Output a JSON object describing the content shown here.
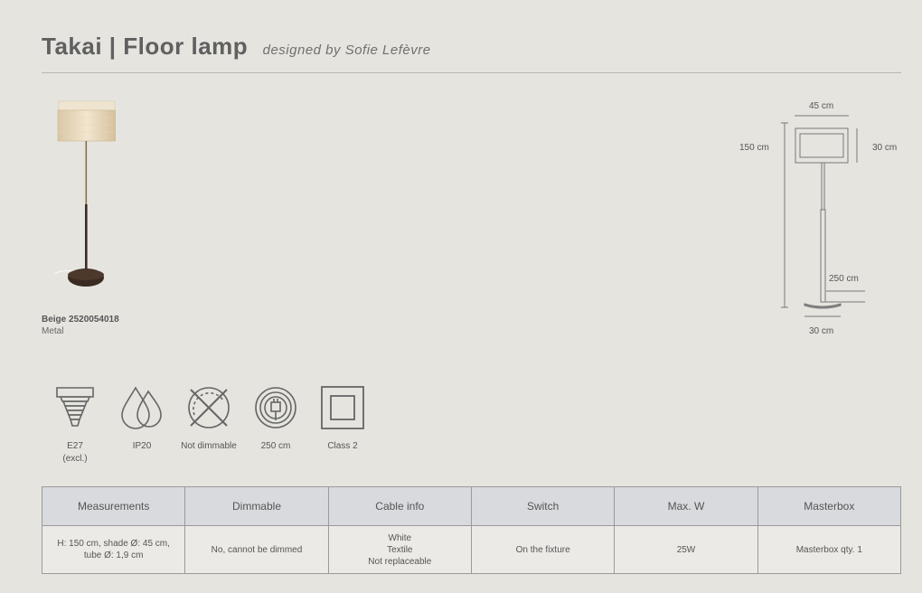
{
  "header": {
    "title": "Takai | Floor lamp",
    "subtitle": "designed by Sofie Lefèvre"
  },
  "product": {
    "variant_code": "Beige 2520054018",
    "material": "Metal"
  },
  "dimensions": {
    "width": "45 cm",
    "height": "150 cm",
    "shade_height": "30 cm",
    "cable": "250 cm",
    "base": "30 cm"
  },
  "features": [
    {
      "icon": "e27-bulb-socket-icon",
      "label": "E27\n(excl.)"
    },
    {
      "icon": "ip20-water-drops-icon",
      "label": "IP20"
    },
    {
      "icon": "not-dimmable-icon",
      "label": "Not dimmable"
    },
    {
      "icon": "cable-length-icon",
      "label": "250 cm"
    },
    {
      "icon": "class-2-icon",
      "label": "Class 2"
    }
  ],
  "specs_table": {
    "headers": [
      "Measurements",
      "Dimmable",
      "Cable info",
      "Switch",
      "Max. W",
      "Masterbox"
    ],
    "values": [
      "H: 150 cm, shade Ø: 45 cm,\ntube Ø: 1,9 cm",
      "No, cannot be dimmed",
      "White\nTextile\nNot replaceable",
      "On the fixture",
      "25W",
      "Masterbox qty. 1"
    ]
  },
  "colors": {
    "background": "#e5e4df",
    "text": "#5a5a5a",
    "table_header_bg": "#d9dade",
    "table_border": "#9a9a9a"
  }
}
